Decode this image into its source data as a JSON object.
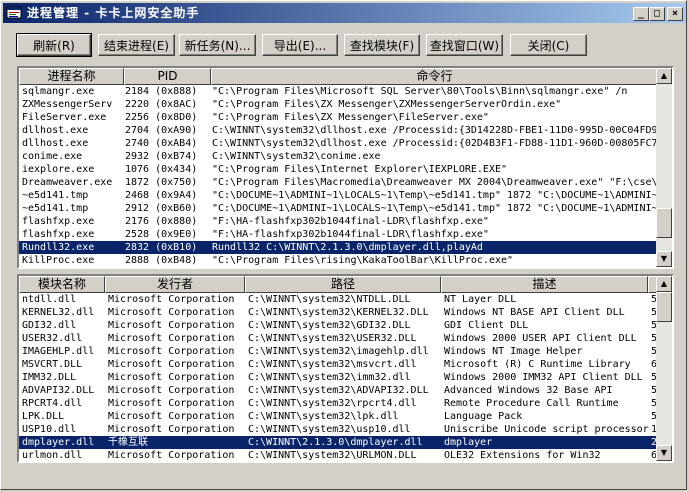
{
  "window": {
    "title": "进程管理 - 卡卡上网安全助手"
  },
  "titlebar_buttons": {
    "minimize": "_",
    "maximize": "□",
    "close": "×"
  },
  "toolbar": {
    "refresh": "刷新(R)",
    "end_process": "结束进程(E)",
    "new_task": "新任务(N)...",
    "export": "导出(E)...",
    "find_module": "查找模块(F)",
    "find_window": "查找窗口(W)",
    "close": "关闭(C)"
  },
  "process_table": {
    "columns": [
      "进程名称",
      "PID",
      "命令行"
    ],
    "rows": [
      [
        "sqlmangr.exe",
        "2184 (0x888)",
        "\"C:\\Program Files\\Microsoft SQL Server\\80\\Tools\\Binn\\sqlmangr.exe\"  /n"
      ],
      [
        "ZXMessengerServ",
        "2220 (0x8AC)",
        "\"C:\\Program Files\\ZX Messenger\\ZXMessengerServerOrdin.exe\""
      ],
      [
        "FileServer.exe",
        "2256 (0x8D0)",
        "\"C:\\Program Files\\ZX Messenger\\FileServer.exe\""
      ],
      [
        "dllhost.exe",
        "2704 (0xA90)",
        "C:\\WINNT\\system32\\dllhost.exe /Processid:{3D14228D-FBE1-11D0-995D-00C04FD9"
      ],
      [
        "dllhost.exe",
        "2740 (0xAB4)",
        "C:\\WINNT\\system32\\dllhost.exe /Processid:{02D4B3F1-FD88-11D1-960D-00805FC7"
      ],
      [
        "conime.exe",
        "2932 (0xB74)",
        "C:\\WINNT\\system32\\conime.exe"
      ],
      [
        "iexplore.exe",
        "1076 (0x434)",
        "\"C:\\Program Files\\Internet Explorer\\IEXPLORE.EXE\""
      ],
      [
        "Dreamweaver.exe",
        "1872 (0x750)",
        "\"C:\\Program Files\\Macromedia\\Dreamweaver MX 2004\\Dreamweaver.exe\" \"F:\\cse\\"
      ],
      [
        "~e5d141.tmp",
        "2468 (0x9A4)",
        "\"C:\\DOCUME~1\\ADMINI~1\\LOCALS~1\\Temp\\~e5d141.tmp\" 1872 \"C:\\DOCUME~1\\ADMINI~"
      ],
      [
        "~e5d141.tmp",
        "2912 (0xB60)",
        "\"C:\\DOCUME~1\\ADMINI~1\\LOCALS~1\\Temp\\~e5d141.tmp\" 1872 \"C:\\DOCUME~1\\ADMINI~"
      ],
      [
        "flashfxp.exe",
        "2176 (0x880)",
        "\"F:\\HA-flashfxp302b1044final-LDR\\flashfxp.exe\""
      ],
      [
        "flashfxp.exe",
        "2528 (0x9E0)",
        "\"F:\\HA-flashfxp302b1044final-LDR\\flashfxp.exe\""
      ],
      [
        "Rundll32.exe",
        "2832 (0xB10)",
        "Rundll32 C:\\WINNT\\2.1.3.0\\dmplayer.dll,playAd"
      ],
      [
        "KillProc.exe",
        "2888 (0xB48)",
        "\"C:\\Program Files\\rising\\KakaToolBar\\KillProc.exe\""
      ]
    ],
    "selected_index": 12
  },
  "module_table": {
    "columns": [
      "模块名称",
      "发行者",
      "路径",
      "描述"
    ],
    "rows": [
      [
        "ntdll.dll",
        "Microsoft Corporation",
        "C:\\WINNT\\system32\\NTDLL.DLL",
        "NT Layer DLL",
        "5."
      ],
      [
        "KERNEL32.dll",
        "Microsoft Corporation",
        "C:\\WINNT\\system32\\KERNEL32.DLL",
        "Windows NT BASE API Client DLL",
        "5."
      ],
      [
        "GDI32.dll",
        "Microsoft Corporation",
        "C:\\WINNT\\system32\\GDI32.DLL",
        "GDI Client DLL",
        "5."
      ],
      [
        "USER32.dll",
        "Microsoft Corporation",
        "C:\\WINNT\\system32\\USER32.DLL",
        "Windows 2000 USER API Client DLL",
        "5."
      ],
      [
        "IMAGEHLP.dll",
        "Microsoft Corporation",
        "C:\\WINNT\\system32\\imagehlp.dll",
        "Windows NT Image Helper",
        "5."
      ],
      [
        "MSVCRT.DLL",
        "Microsoft Corporation",
        "C:\\WINNT\\system32\\msvcrt.dll",
        "Microsoft (R) C Runtime Library",
        "6."
      ],
      [
        "IMM32.DLL",
        "Microsoft Corporation",
        "C:\\WINNT\\system32\\imm32.dll",
        "Windows 2000 IMM32 API Client DLL",
        "5."
      ],
      [
        "ADVAPI32.DLL",
        "Microsoft Corporation",
        "C:\\WINNT\\system32\\ADVAPI32.DLL",
        "Advanced Windows 32 Base API",
        "5."
      ],
      [
        "RPCRT4.dll",
        "Microsoft Corporation",
        "C:\\WINNT\\system32\\rpcrt4.dll",
        "Remote Procedure Call Runtime",
        "5."
      ],
      [
        "LPK.DLL",
        "Microsoft Corporation",
        "C:\\WINNT\\system32\\lpk.dll",
        "Language Pack",
        "5."
      ],
      [
        "USP10.dll",
        "Microsoft Corporation",
        "C:\\WINNT\\system32\\usp10.dll",
        "Uniscribe Unicode script processor",
        "1."
      ],
      [
        "dmplayer.dll",
        "千橡互联",
        "C:\\WINNT\\2.1.3.0\\dmplayer.dll",
        "dmplayer",
        "2."
      ],
      [
        "urlmon.dll",
        "Microsoft Corporation",
        "C:\\WINNT\\system32\\URLMON.DLL",
        "OLE32 Extensions for Win32",
        "6."
      ]
    ],
    "selected_index": 11
  },
  "colors": {
    "selection": "#0a246a",
    "face": "#d4d0c8",
    "title_start": "#0a246a",
    "title_end": "#a6caf0"
  },
  "icons": {
    "app": "process-manager-icon",
    "scroll_up": "arrow-up-icon",
    "scroll_down": "arrow-down-icon"
  }
}
